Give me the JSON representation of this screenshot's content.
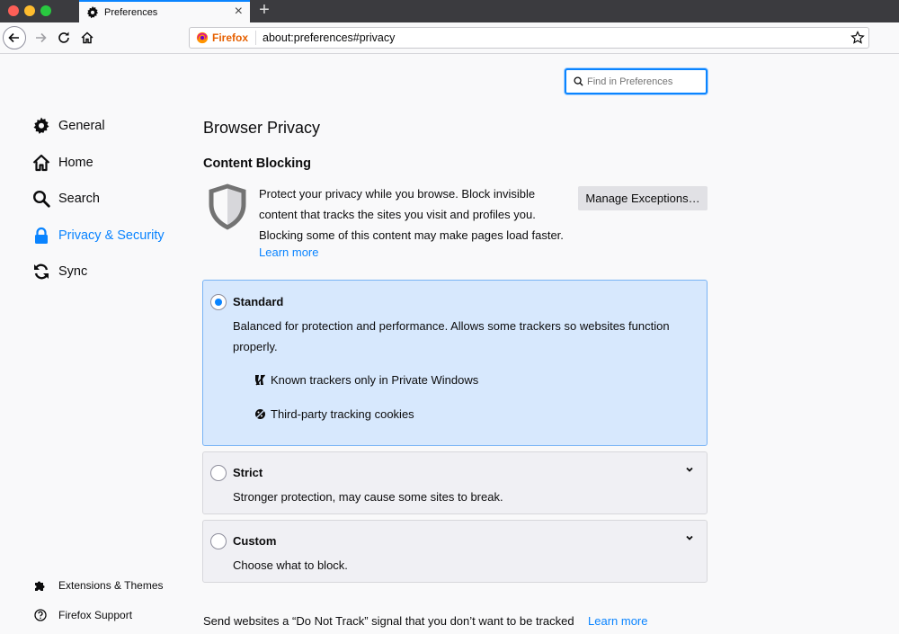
{
  "tab": {
    "title": "Preferences",
    "close": "×",
    "new_tab": "+"
  },
  "urlbar": {
    "identity": "Firefox",
    "url": "about:preferences#privacy"
  },
  "search": {
    "placeholder": "Find in Preferences"
  },
  "sidebar": {
    "items": [
      {
        "label": "General",
        "icon": "gear-icon"
      },
      {
        "label": "Home",
        "icon": "home-icon"
      },
      {
        "label": "Search",
        "icon": "search-icon"
      },
      {
        "label": "Privacy & Security",
        "icon": "lock-icon",
        "selected": true
      },
      {
        "label": "Sync",
        "icon": "sync-icon"
      }
    ],
    "footer": [
      {
        "label": "Extensions & Themes",
        "icon": "puzzle-icon"
      },
      {
        "label": "Firefox Support",
        "icon": "help-icon"
      }
    ]
  },
  "main": {
    "title": "Browser Privacy",
    "section": "Content Blocking",
    "blurb": "Protect your privacy while you browse. Block invisible content that tracks the sites you visit and profiles you. Blocking some of this content may make pages load faster.",
    "learn_more": "Learn more",
    "manage_button": "Manage Exceptions…",
    "options": [
      {
        "title": "Standard",
        "desc": "Balanced for protection and performance. Allows some trackers so websites function properly.",
        "selected": true,
        "features": [
          "Known trackers only in Private Windows",
          "Third-party tracking cookies"
        ]
      },
      {
        "title": "Strict",
        "desc": "Stronger protection, may cause some sites to break.",
        "selected": false
      },
      {
        "title": "Custom",
        "desc": "Choose what to block.",
        "selected": false
      }
    ],
    "dnt_text": "Send websites a “Do Not Track” signal that you don’t want to be tracked",
    "dnt_link": "Learn more"
  },
  "colors": {
    "accent": "#0a84ff",
    "selected_bg": "#d7e8fd"
  }
}
